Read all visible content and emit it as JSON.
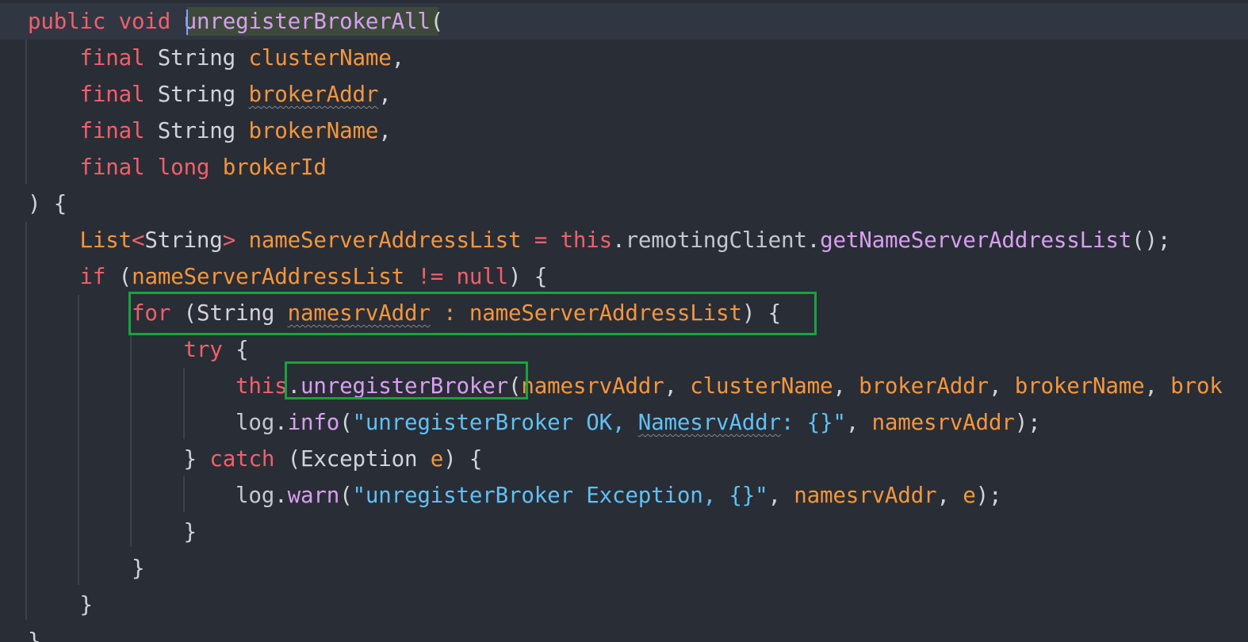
{
  "code": {
    "l1": {
      "kw1": "public",
      "kw2": "void",
      "fn": "unregisterBrokerAll",
      "p": "("
    },
    "l2": {
      "kw": "final",
      "typ": "String",
      "var": "clusterName",
      "p": ","
    },
    "l3": {
      "kw": "final",
      "typ": "String",
      "var": "brokerAddr",
      "p": ","
    },
    "l4": {
      "kw": "final",
      "typ": "String",
      "var": "brokerName",
      "p": ","
    },
    "l5": {
      "kw": "final",
      "typ": "long",
      "var": "brokerId"
    },
    "l6": {
      "p": ") {"
    },
    "l7": {
      "t1": "List",
      "lt": "<",
      "t2": "String",
      "gt": ">",
      "var": "nameServerAddressList",
      "eq": "=",
      "kw": "this",
      "dot": ".",
      "fld": "remotingClient",
      "dot2": ".",
      "fn": "getNameServerAddressList",
      "p": "();"
    },
    "l8": {
      "kw": "if",
      "p1": "(",
      "var": "nameServerAddressList",
      "op": "!=",
      "kw2": "null",
      "p2": ") {"
    },
    "l9": {
      "kw": "for",
      "p1": "(",
      "typ": "String",
      "var": "namesrvAddr",
      "colon": ":",
      "var2": "nameServerAddressList",
      "p2": ") {"
    },
    "l10": {
      "kw": "try",
      "p": "{"
    },
    "l11": {
      "kw": "this",
      "dot": ".",
      "fn": "unregisterBroker",
      "p1": "(",
      "a1": "namesrvAddr",
      "c1": ", ",
      "a2": "clusterName",
      "c2": ", ",
      "a3": "brokerAddr",
      "c3": ", ",
      "a4": "brokerName",
      "c4": ", ",
      "a5": "brok"
    },
    "l12": {
      "obj": "log",
      "dot": ".",
      "fn": "info",
      "p1": "(",
      "s1": "\"unregisterBroker OK, ",
      "s2": "NamesrvAddr",
      "s3": ": {}\"",
      "c": ", ",
      "var": "namesrvAddr",
      "p2": ");"
    },
    "l13": {
      "p1": "}",
      "kw": "catch",
      "p2": "(",
      "typ": "Exception",
      "var": "e",
      "p3": ") {"
    },
    "l14": {
      "obj": "log",
      "dot": ".",
      "fn": "warn",
      "p1": "(",
      "s": "\"unregisterBroker Exception, {}\"",
      "c1": ", ",
      "var": "namesrvAddr",
      "c2": ", ",
      "var2": "e",
      "p2": ");"
    },
    "l15": {
      "p": "}"
    },
    "l16": {
      "p": "}"
    },
    "l17": {
      "p": "}"
    },
    "l18": {
      "p": "}"
    }
  },
  "theme": {
    "background": "#292d36",
    "keyword": "#f0606a",
    "variable": "#f4963d",
    "function": "#d89ff0",
    "string": "#5fc1f4",
    "highlight_box": "#18a33e"
  }
}
